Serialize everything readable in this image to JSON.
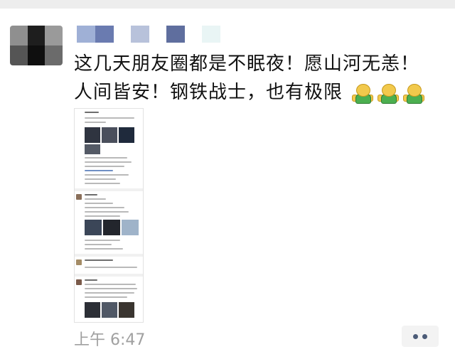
{
  "post": {
    "line1": "这几天朋友圈都是不眠夜！愿山河无恙！",
    "line2": "人间皆安！钢铁战士，也有极限",
    "emoji_count": 3,
    "emoji_icon": "green-shirt-person-emoji"
  },
  "avatar_colors": [
    "#8f8f8f",
    "#1e1e1e",
    "#9a9a9a",
    "#555555",
    "#0f0f0f",
    "#6b6b6b"
  ],
  "name_blur_colors": [
    "#9fb0d6",
    "#6a7bb0",
    "#ffffff",
    "#b8c2db",
    "#ffffff",
    "#5f6e9e",
    "#ffffff",
    "#e9f5f5"
  ],
  "timestamp": "上午 6:47",
  "actions": {
    "more_icon": "more-dots-icon"
  }
}
